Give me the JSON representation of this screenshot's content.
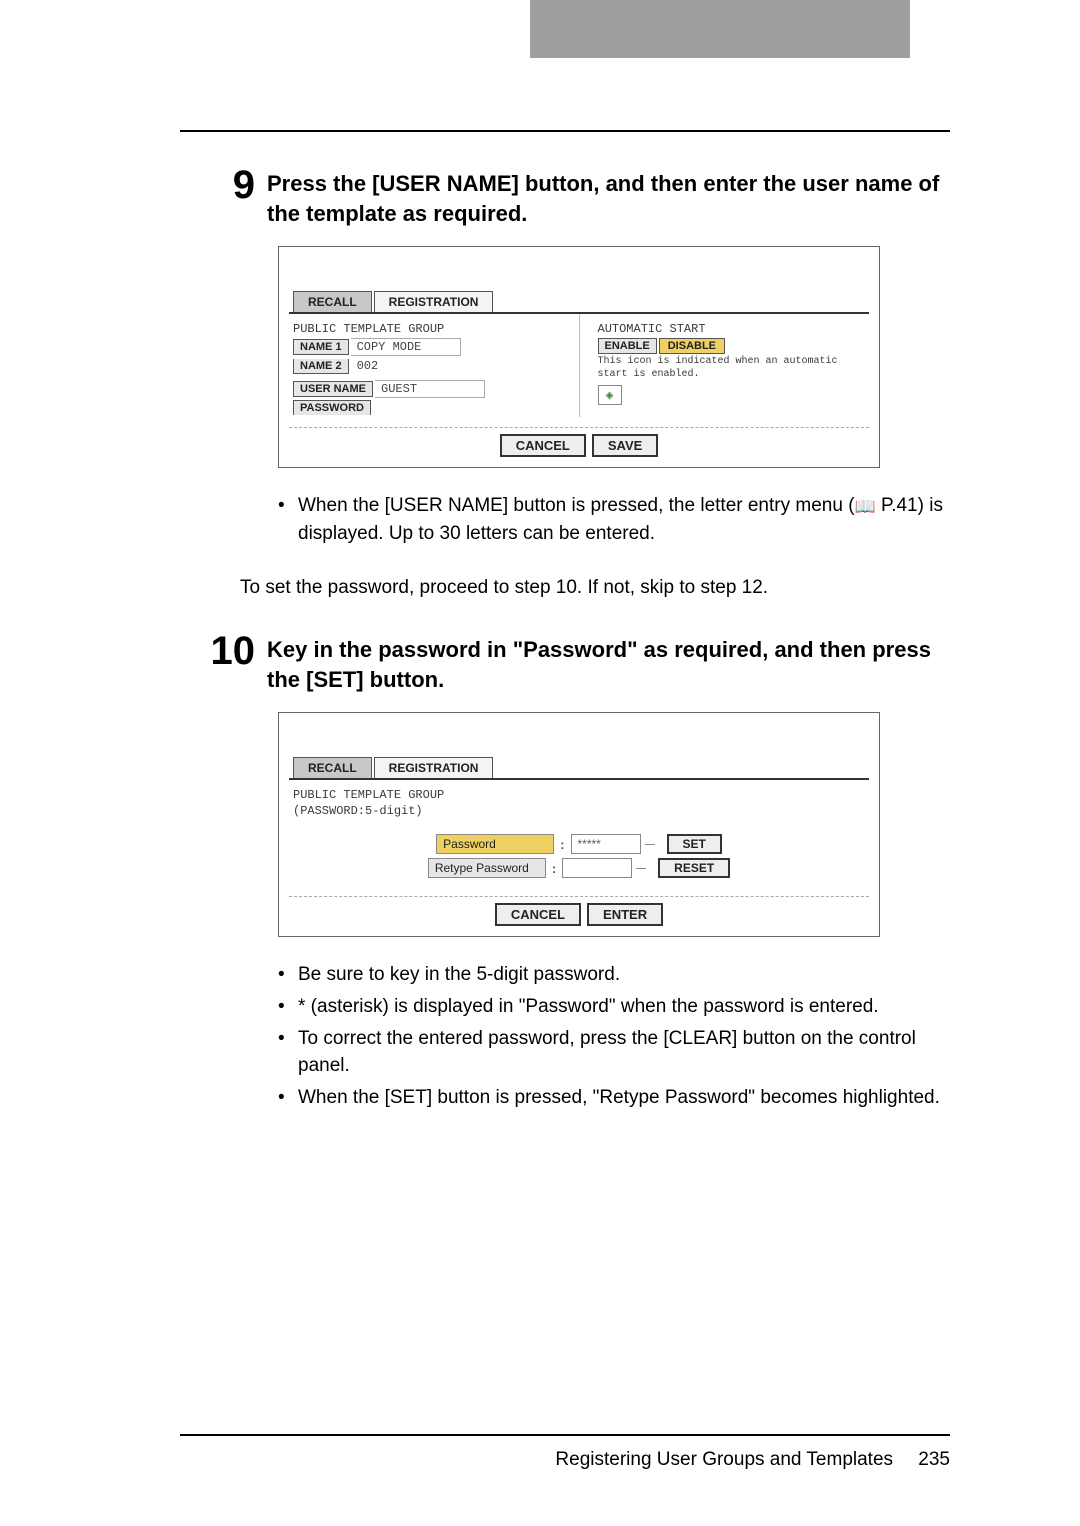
{
  "steps": {
    "s9": {
      "num": "9",
      "text": "Press the [USER NAME] button, and then enter the user name of the template as required."
    },
    "s10": {
      "num": "10",
      "text": "Key in the password in \"Password\" as required, and then press the [SET] button."
    }
  },
  "ss1": {
    "tabs": {
      "recall": "RECALL",
      "registration": "REGISTRATION"
    },
    "group_label": "PUBLIC TEMPLATE GROUP",
    "name1_btn": "NAME 1",
    "name1_val": "COPY MODE",
    "name2_btn": "NAME 2",
    "name2_val": "002",
    "username_btn": "USER NAME",
    "username_val": "GUEST",
    "password_btn": "PASSWORD",
    "auto_start": "AUTOMATIC START",
    "enable": "ENABLE",
    "disable": "DISABLE",
    "hint1": "This icon is indicated when an automatic",
    "hint2": "start is enabled.",
    "cancel": "CANCEL",
    "save": "SAVE"
  },
  "after9": {
    "b1a": "When the [USER NAME] button is pressed, the letter entry menu (",
    "b1b": " P.41) is displayed. Up to 30 letters can be entered.",
    "para": "To set the password, proceed to step 10. If not, skip to step 12."
  },
  "ss2": {
    "tabs": {
      "recall": "RECALL",
      "registration": "REGISTRATION"
    },
    "group_label1": "PUBLIC TEMPLATE GROUP",
    "group_label2": "(PASSWORD:5-digit)",
    "password_label": "Password",
    "password_val": "*****",
    "retype_label": "Retype Password",
    "set": "SET",
    "reset": "RESET",
    "cancel": "CANCEL",
    "enter": "ENTER"
  },
  "after10": {
    "b1": "Be sure to key in the 5-digit password.",
    "b2": " * (asterisk) is displayed in \"Password\" when the password is entered.",
    "b3": "To correct the entered password, press the [CLEAR] button on the control panel.",
    "b4": "When the [SET] button is pressed, \"Retype Password\" becomes highlighted."
  },
  "footer": {
    "title": "Registering User Groups and Templates",
    "page": "235"
  }
}
